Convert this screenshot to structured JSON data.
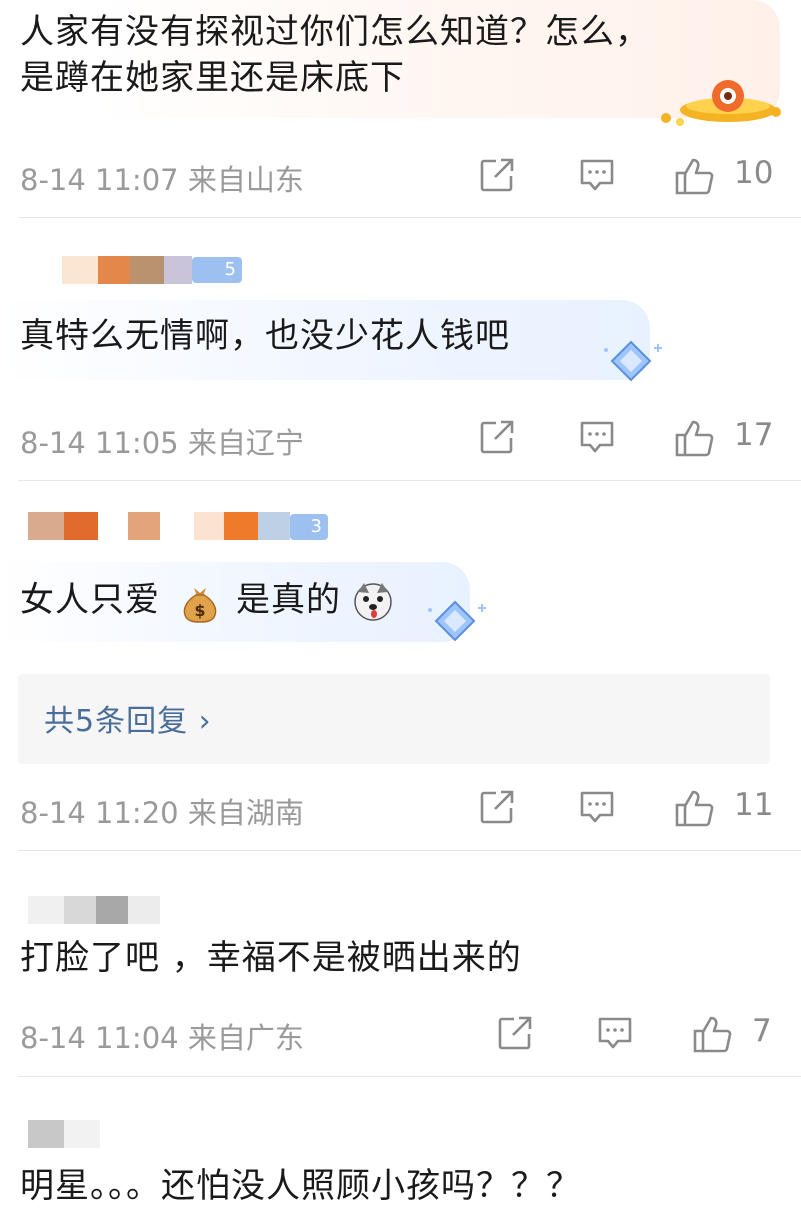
{
  "comments": [
    {
      "text_lines": [
        "人家有没有探视过你们怎么知道？怎么，",
        "是蹲在她家里还是床底下"
      ],
      "meta": "8-14 11:07 来自山东",
      "likes": "10"
    },
    {
      "badge": "5",
      "text": "真特么无情啊，也没少花人钱吧",
      "meta": "8-14 11:05 来自辽宁",
      "likes": "17"
    },
    {
      "badge": "3",
      "text_a": "女人只爱",
      "text_b": "是真的",
      "reply_link": "共5条回复 ›",
      "meta": "8-14 11:20 来自湖南",
      "likes": "11"
    },
    {
      "text": "打脸了吧 ，幸福不是被晒出来的",
      "meta": "8-14 11:04 来自广东",
      "likes": "7"
    },
    {
      "text": "明星。。。还怕没人照顾小孩吗？？？"
    }
  ],
  "icons": {
    "share": "share-icon",
    "comment": "comment-icon",
    "like": "thumbs-up-icon",
    "money_bag": "money-bag-emoji",
    "dog": "dog-face-emoji",
    "gem": "diamond-badge-icon",
    "ufo": "gold-ufo-sticker"
  },
  "colors": {
    "meta_gray": "#9a9a9a",
    "reply_blue": "#4a6d9a",
    "badge_blue": "#9cc0ef"
  }
}
